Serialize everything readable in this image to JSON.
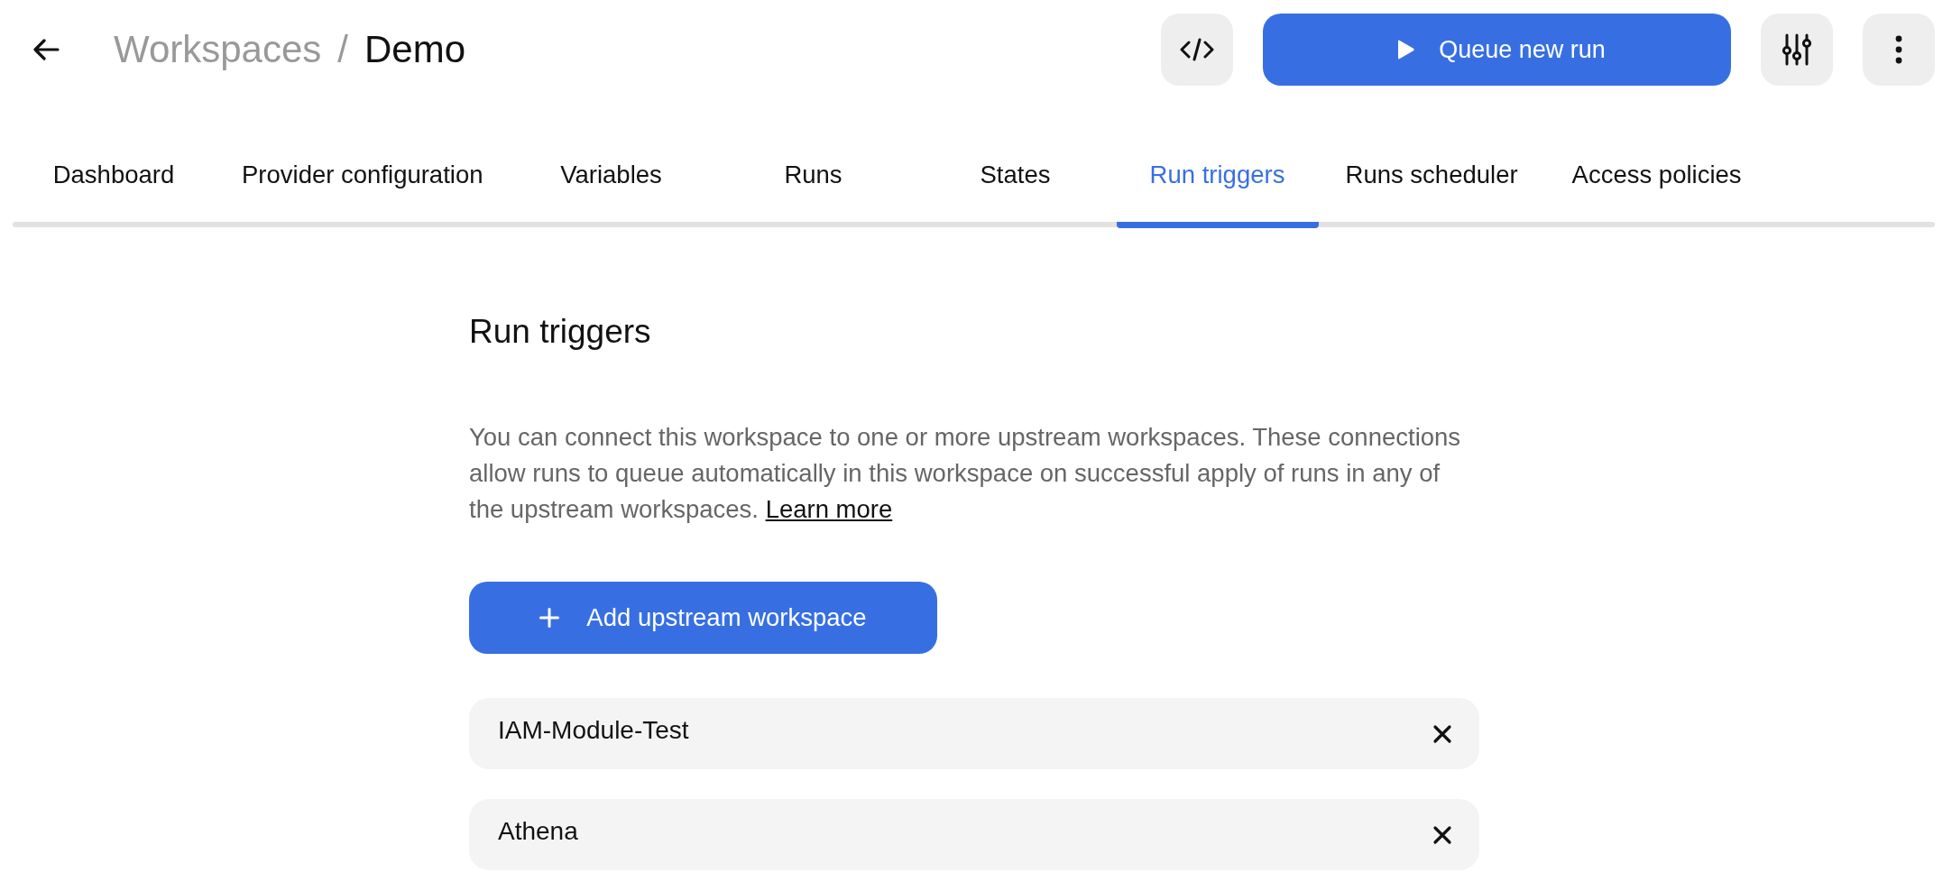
{
  "header": {
    "breadcrumb": [
      {
        "label": "Workspaces",
        "current": false
      },
      {
        "label": "Demo",
        "current": true
      }
    ],
    "separator": "/",
    "actions": [
      {
        "kind": "code"
      },
      {
        "kind": "primary",
        "label": "Queue new run"
      },
      {
        "kind": "filters"
      },
      {
        "kind": "more"
      }
    ]
  },
  "tabs": [
    {
      "label": "Dashboard",
      "selected": false
    },
    {
      "label": "Provider configuration",
      "selected": false
    },
    {
      "label": "Variables",
      "selected": false
    },
    {
      "label": "Runs",
      "selected": false
    },
    {
      "label": "States",
      "selected": false
    },
    {
      "label": "Run triggers",
      "selected": true
    },
    {
      "label": "Runs scheduler",
      "selected": false
    },
    {
      "label": "Access policies",
      "selected": false
    }
  ],
  "section": {
    "title": "Run triggers",
    "description": "You can connect this workspace to one or more upstream workspaces. These connections allow runs to queue automatically in this workspace on successful apply of runs in any of the upstream workspaces.",
    "link": "Learn more",
    "add_button": "Add upstream workspace"
  },
  "upstream_workspaces": [
    {
      "name": "IAM-Module-Test"
    },
    {
      "name": "Athena"
    }
  ]
}
